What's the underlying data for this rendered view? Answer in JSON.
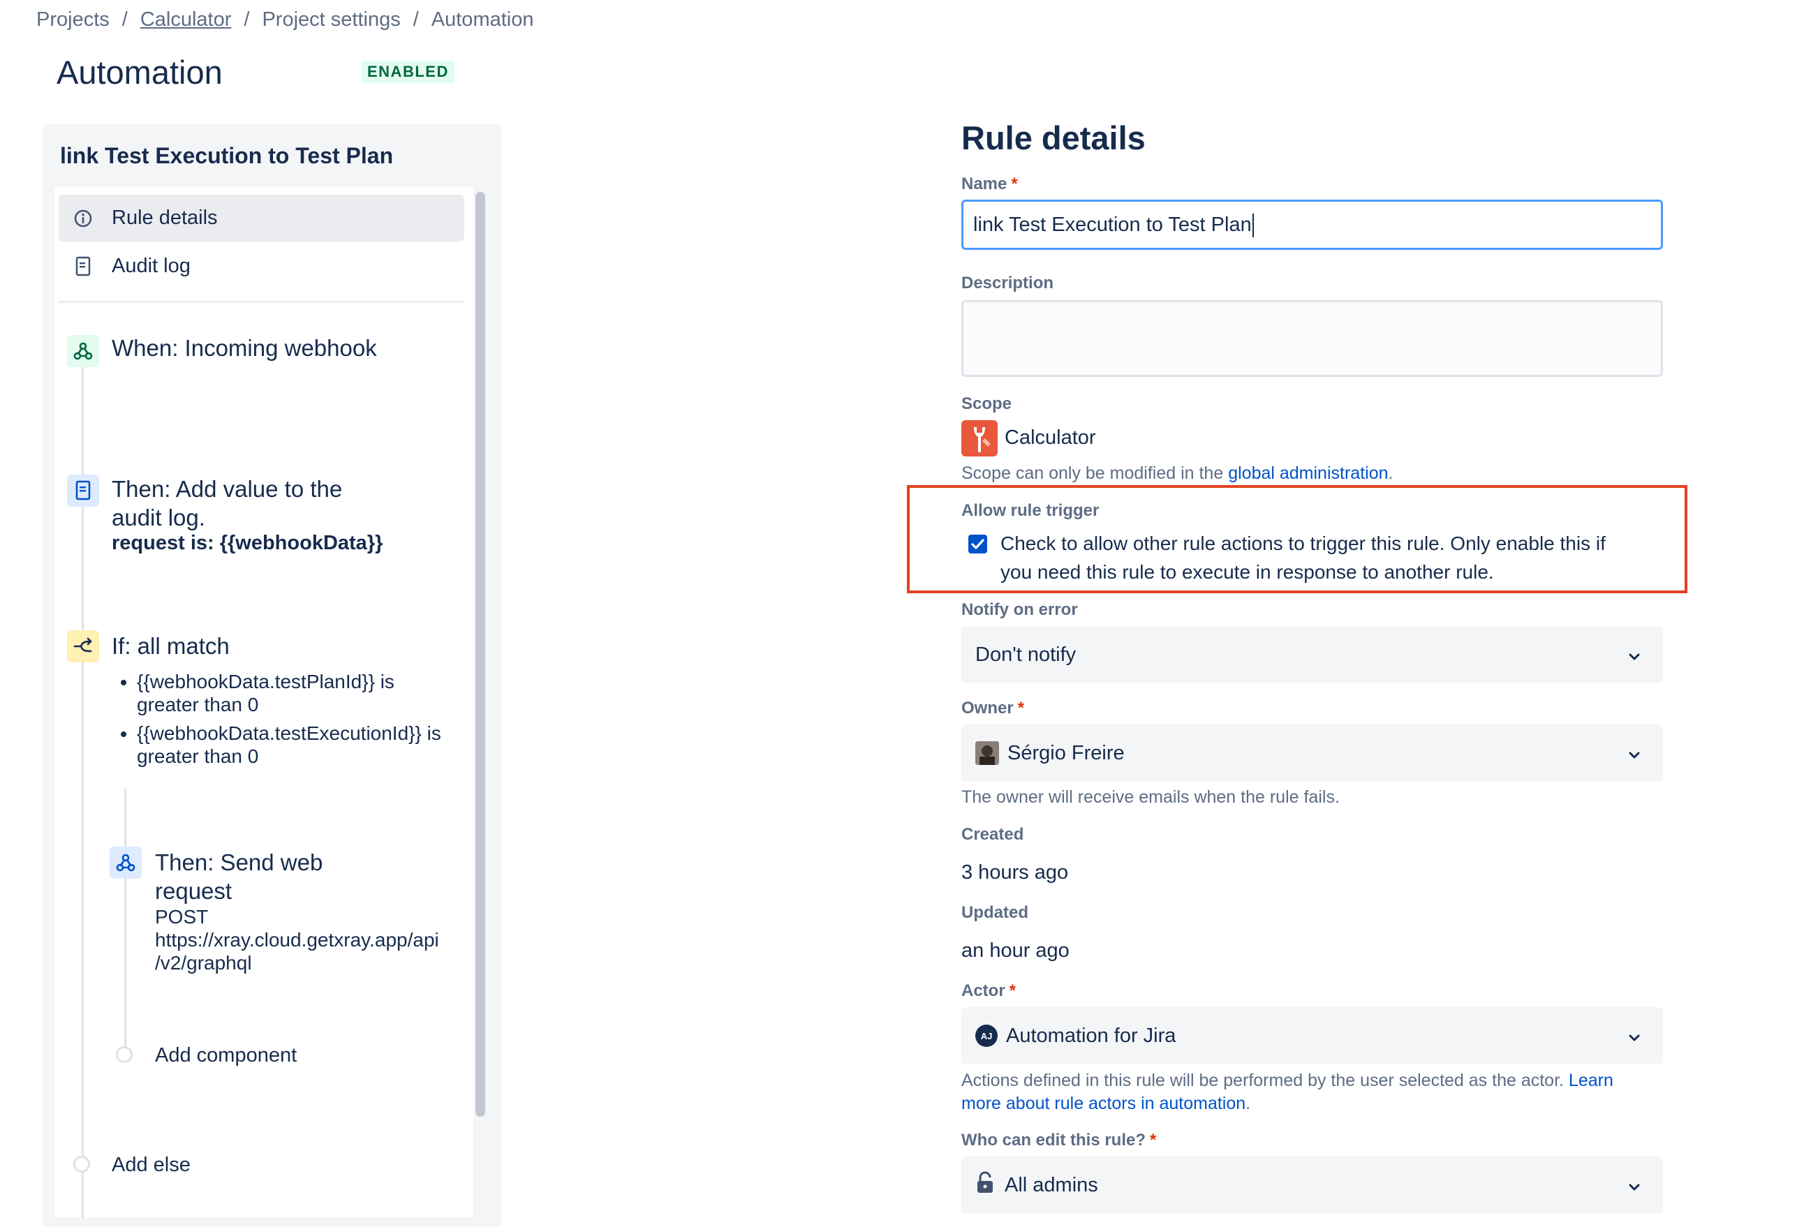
{
  "breadcrumb": {
    "items": [
      "Projects",
      "Calculator",
      "Project settings",
      "Automation"
    ],
    "separator": "/"
  },
  "page": {
    "title": "Automation",
    "status_badge": "ENABLED"
  },
  "rule_panel": {
    "rule_name": "link Test Execution to Test Plan",
    "nav": [
      {
        "label": "Rule details",
        "icon": "info-icon",
        "selected": true
      },
      {
        "label": "Audit log",
        "icon": "document-icon",
        "selected": false
      }
    ],
    "trigger": {
      "title": "When: Incoming webhook",
      "icon": "webhook-icon"
    },
    "action_log": {
      "title_line1": "Then: Add value to the",
      "title_line2": "audit log.",
      "detail": "request is: {{webhookData}}",
      "icon": "audit-log-icon"
    },
    "condition": {
      "title": "If: all match",
      "icon": "branch-icon",
      "items": [
        {
          "line1": "{{webhookData.testPlanId}} is",
          "line2": "greater than 0"
        },
        {
          "line1": "{{webhookData.testExecutionId}} is",
          "line2": "greater than 0"
        }
      ]
    },
    "web_request": {
      "title_line1": "Then: Send web",
      "title_line2": "request",
      "method": "POST",
      "url_line1": "https://xray.cloud.getxray.app/api",
      "url_line2": "/v2/graphql",
      "icon": "webhook-icon"
    },
    "add_component_label": "Add component",
    "add_else_label": "Add else"
  },
  "rule_details": {
    "heading": "Rule details",
    "name_label": "Name",
    "name_value": "link Test Execution to Test Plan",
    "description_label": "Description",
    "description_value": "",
    "scope_label": "Scope",
    "scope_value": "Calculator",
    "scope_help_prefix": "Scope can only be modified in the ",
    "scope_help_link": "global administration",
    "scope_help_suffix": ".",
    "allow_trigger_label": "Allow rule trigger",
    "allow_trigger_checked": true,
    "allow_trigger_line1": "Check to allow other rule actions to trigger this rule. Only enable this if",
    "allow_trigger_line2": "you need this rule to execute in response to another rule.",
    "notify_label": "Notify on error",
    "notify_value": "Don't notify",
    "owner_label": "Owner",
    "owner_value": "Sérgio Freire",
    "owner_help": "The owner will receive emails when the rule fails.",
    "created_label": "Created",
    "created_value": "3 hours ago",
    "updated_label": "Updated",
    "updated_value": "an hour ago",
    "actor_label": "Actor",
    "actor_avatar": "AJ",
    "actor_value": "Automation for Jira",
    "actor_help_line1": "Actions defined in this rule will be performed by the user selected as the actor. ",
    "actor_help_link1": "Learn",
    "actor_help_link2": "more about rule actors in automation",
    "actor_help_suffix": ".",
    "edit_label": "Who can edit this rule?",
    "edit_value": "All admins"
  },
  "colors": {
    "accent": "#0052cc",
    "highlight_box": "#e2421f",
    "badge_bg": "#e3fcef",
    "badge_text": "#006644"
  }
}
